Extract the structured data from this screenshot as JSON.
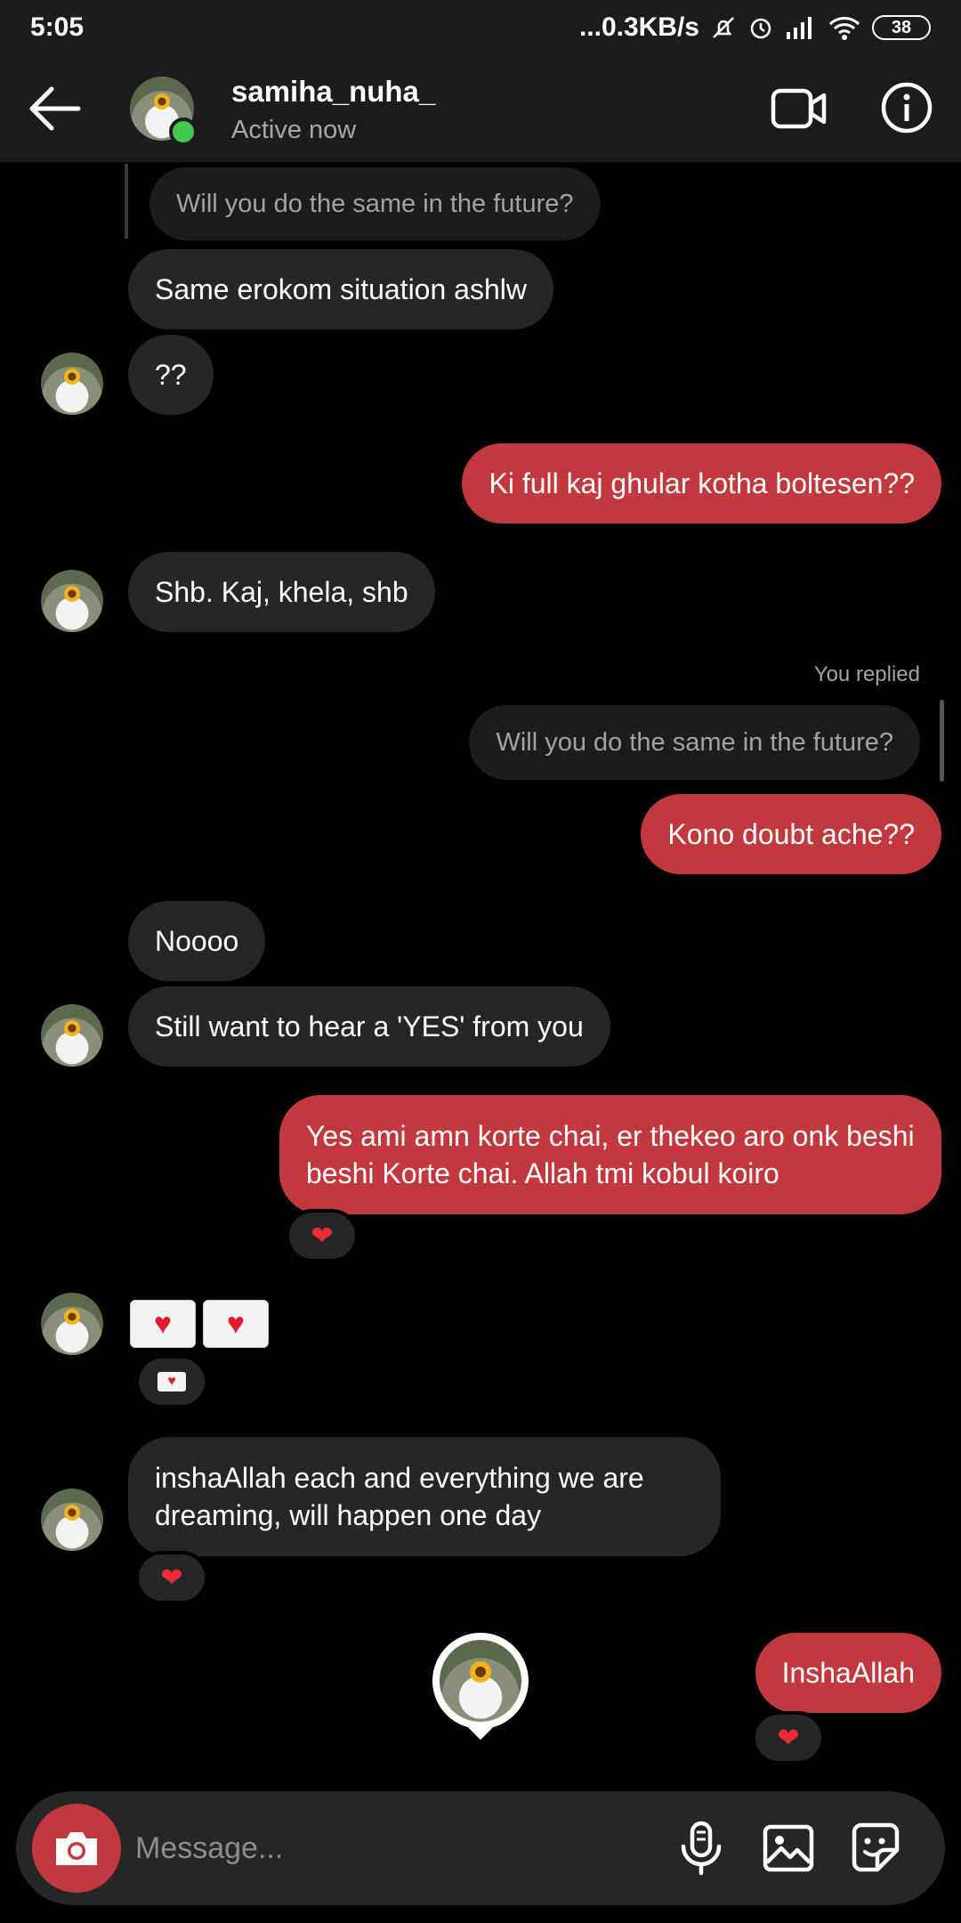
{
  "status_bar": {
    "time": "5:05",
    "network": "...0.3KB/s",
    "battery": "38"
  },
  "header": {
    "username": "samiha_nuha_",
    "status": "Active now"
  },
  "messages": {
    "m1_reply_quote": "Will you do the same in the future?",
    "m2": "Same erokom situation ashlw",
    "m3": "??",
    "m4": "Ki full kaj ghular kotha boltesen??",
    "m5": "Shb. Kaj, khela, shb",
    "you_replied": "You replied",
    "m6_reply_quote": "Will you do the same in the future?",
    "m7": "Kono doubt ache??",
    "m8": "Noooo",
    "m9": "Still want to hear a 'YES' from you",
    "m10": "Yes ami amn korte chai, er thekeo aro onk beshi beshi Korte chai. Allah tmi kobul koiro",
    "m11": "inshaAllah each and everything we are dreaming, will happen one day",
    "m12": "InshaAllah"
  },
  "reactions": {
    "heart": "❤",
    "letter_heart": "♥"
  },
  "composer": {
    "placeholder": "Message..."
  },
  "icons": {
    "back": "arrow-left-icon",
    "video": "video-camera-icon",
    "info": "info-icon",
    "camera": "camera-icon",
    "mic": "microphone-icon",
    "gallery": "image-icon",
    "sticker": "sticker-icon"
  },
  "colors": {
    "outgoing_bubble": "#c1393e",
    "incoming_bubble": "#262626",
    "background": "#000000",
    "online_dot": "#42c84d"
  }
}
